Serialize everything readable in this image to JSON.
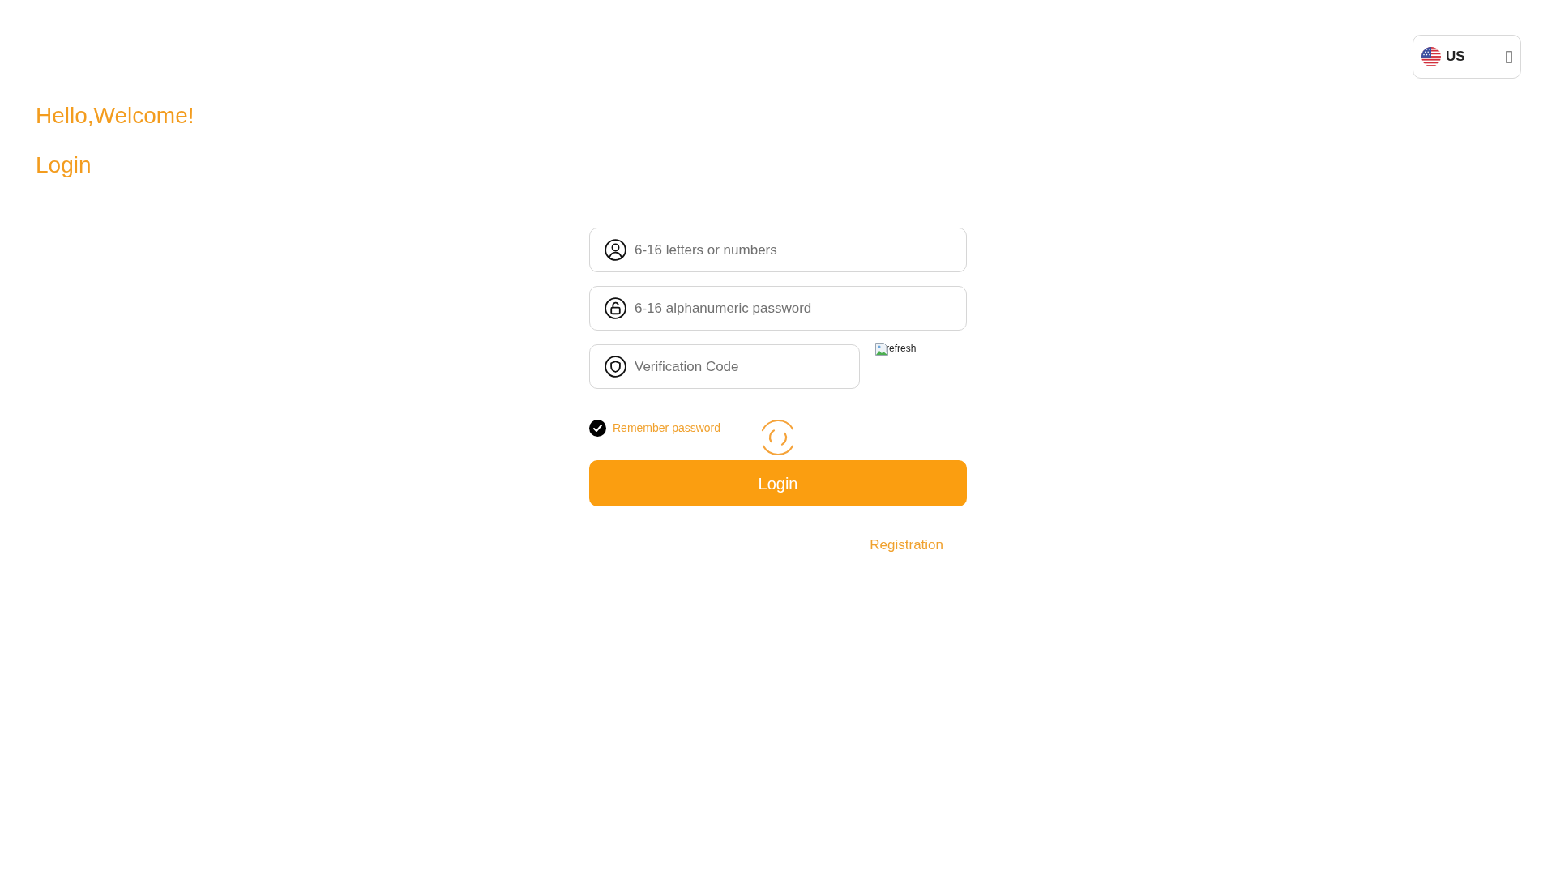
{
  "language_selector": {
    "label": "US"
  },
  "greeting": "Hello,Welcome!",
  "title": "Login",
  "form": {
    "fields": [
      {
        "kind": "username",
        "placeholder": "6-16 letters or numbers"
      },
      {
        "kind": "password",
        "placeholder": "6-16 alphanumeric password"
      },
      {
        "kind": "captcha",
        "placeholder": "Verification Code"
      }
    ],
    "captcha_image": {
      "alt": "refresh"
    },
    "remember_password": {
      "label": "Remember password",
      "checked": true
    },
    "loading": true,
    "submit_button": "Login",
    "registration_link": "Registration"
  }
}
